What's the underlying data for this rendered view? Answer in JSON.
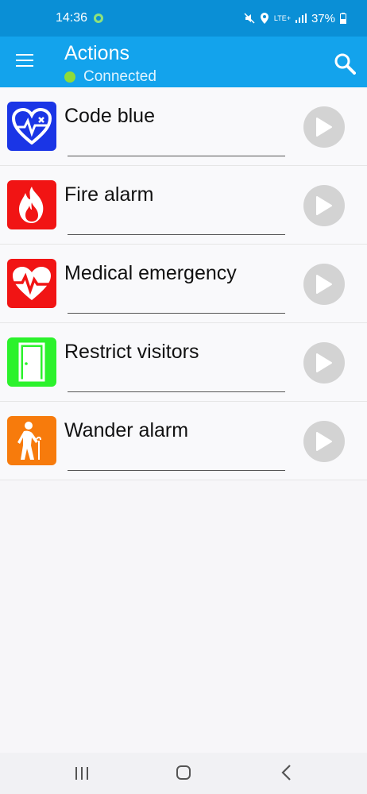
{
  "status_bar": {
    "time": "14:36",
    "battery": "37%",
    "network": "LTE+"
  },
  "app_bar": {
    "title": "Actions",
    "connection_status": "Connected",
    "connection_color": "#8edb3a",
    "primary_color": "#13a3ec"
  },
  "actions": [
    {
      "label": "Code blue",
      "icon": "heart-ecg-icon",
      "color": "#1a35e6"
    },
    {
      "label": "Fire alarm",
      "icon": "fire-icon",
      "color": "#f11414"
    },
    {
      "label": "Medical emergency",
      "icon": "heart-pulse-icon",
      "color": "#f11414"
    },
    {
      "label": "Restrict visitors",
      "icon": "door-icon",
      "color": "#2cf22c"
    },
    {
      "label": "Wander alarm",
      "icon": "elderly-person-icon",
      "color": "#f77b0c"
    }
  ]
}
